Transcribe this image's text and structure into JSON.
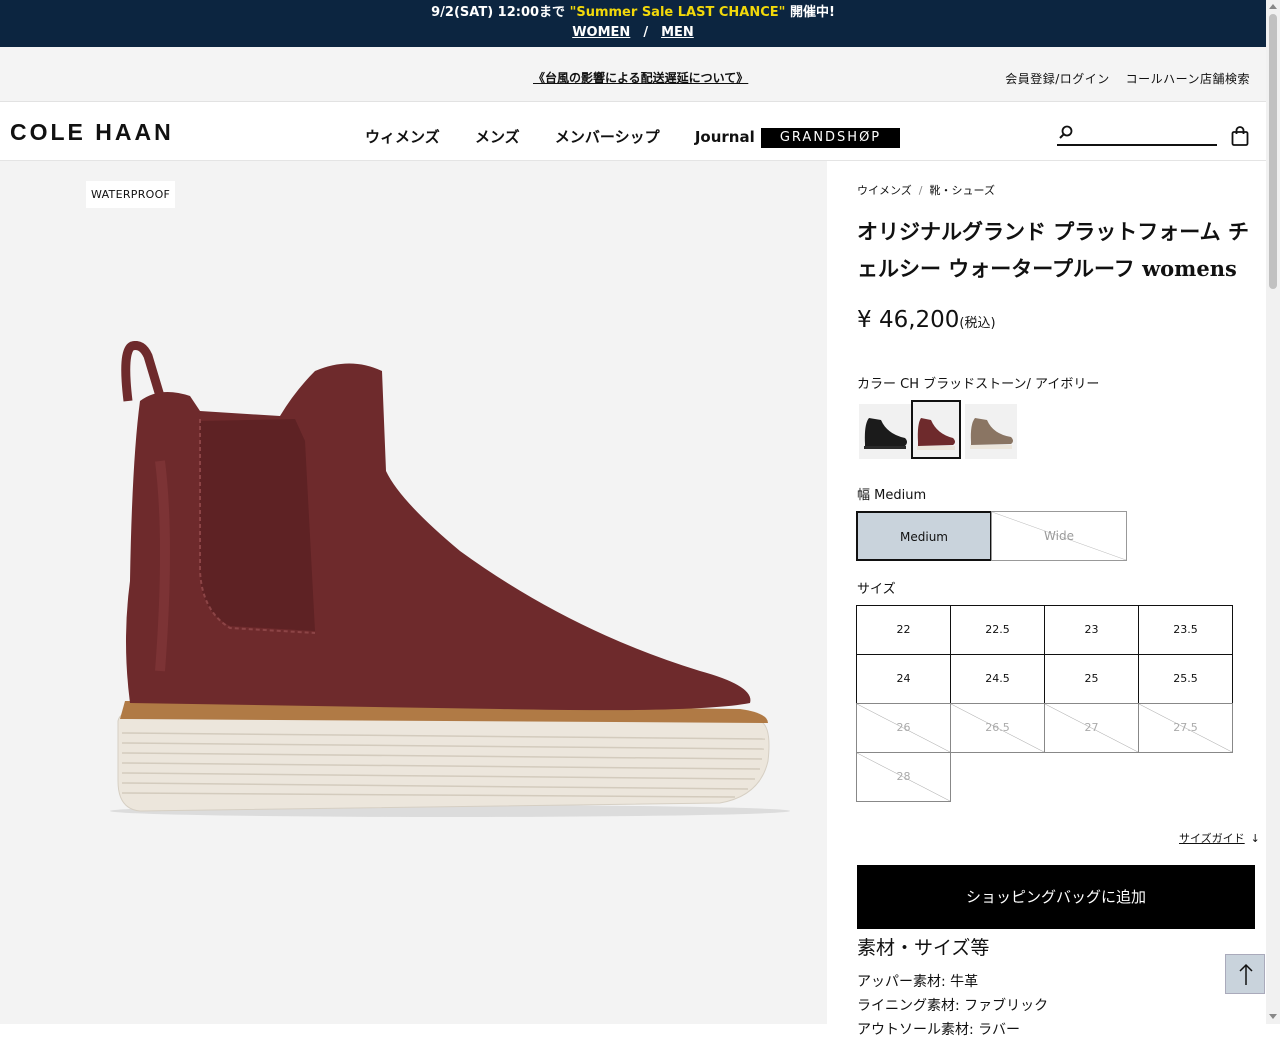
{
  "promo": {
    "prefix": "9/2(SAT) 12:00まで",
    "highlight": "\"Summer Sale LAST CHANCE\"",
    "suffix": "開催中!",
    "link_women": "WOMEN",
    "separator": "/",
    "link_men": "MEN"
  },
  "util": {
    "notice": "《台風の影響による配送遅延について》",
    "login": "会員登録/ログイン",
    "stores": "コールハーン店舗検索"
  },
  "header": {
    "logo": "COLE HAAN",
    "nav": [
      "ウィメンズ",
      "メンズ",
      "メンバーシップ",
      "Journal"
    ],
    "grandshop": "GRANDSHØP",
    "search_placeholder": ""
  },
  "image": {
    "badge": "WATERPROOF"
  },
  "product": {
    "breadcrumb": [
      "ウイメンズ",
      "靴・シューズ"
    ],
    "breadcrumb_sep": "/",
    "title": "オリジナルグランド プラットフォーム チェルシー ウォータープルーフ womens",
    "price": "¥ 46,200",
    "price_tax": "(税込)",
    "color_label": "カラー CH ブラッドストーン/ アイボリー",
    "swatches": [
      {
        "name": "black",
        "color": "#1b1b1b",
        "selected": false
      },
      {
        "name": "bloodstone",
        "color": "#6e2a2c",
        "selected": true
      },
      {
        "name": "taupe",
        "color": "#8a7563",
        "selected": false
      }
    ],
    "width_label": "幅 Medium",
    "widths": [
      {
        "label": "Medium",
        "available": true,
        "selected": true
      },
      {
        "label": "Wide",
        "available": false,
        "selected": false
      }
    ],
    "size_label": "サイズ",
    "sizes": [
      {
        "label": "22",
        "available": true
      },
      {
        "label": "22.5",
        "available": true
      },
      {
        "label": "23",
        "available": true
      },
      {
        "label": "23.5",
        "available": true
      },
      {
        "label": "24",
        "available": true
      },
      {
        "label": "24.5",
        "available": true
      },
      {
        "label": "25",
        "available": true
      },
      {
        "label": "25.5",
        "available": true
      },
      {
        "label": "26",
        "available": false
      },
      {
        "label": "26.5",
        "available": false
      },
      {
        "label": "27",
        "available": false
      },
      {
        "label": "27.5",
        "available": false
      },
      {
        "label": "28",
        "available": false
      }
    ],
    "size_guide": "サイズガイド",
    "add_to_bag": "ショッピングバッグに追加",
    "spec_heading": "素材・サイズ等",
    "spec_upper": "アッパー素材: 牛革",
    "spec_lining": "ライニング素材: ファブリック",
    "spec_outsole": "アウトソール素材: ラバー"
  },
  "colors": {
    "promo_bg": "#0c2540",
    "highlight": "#f2d80a",
    "selected_width_bg": "#c9d3dc"
  }
}
